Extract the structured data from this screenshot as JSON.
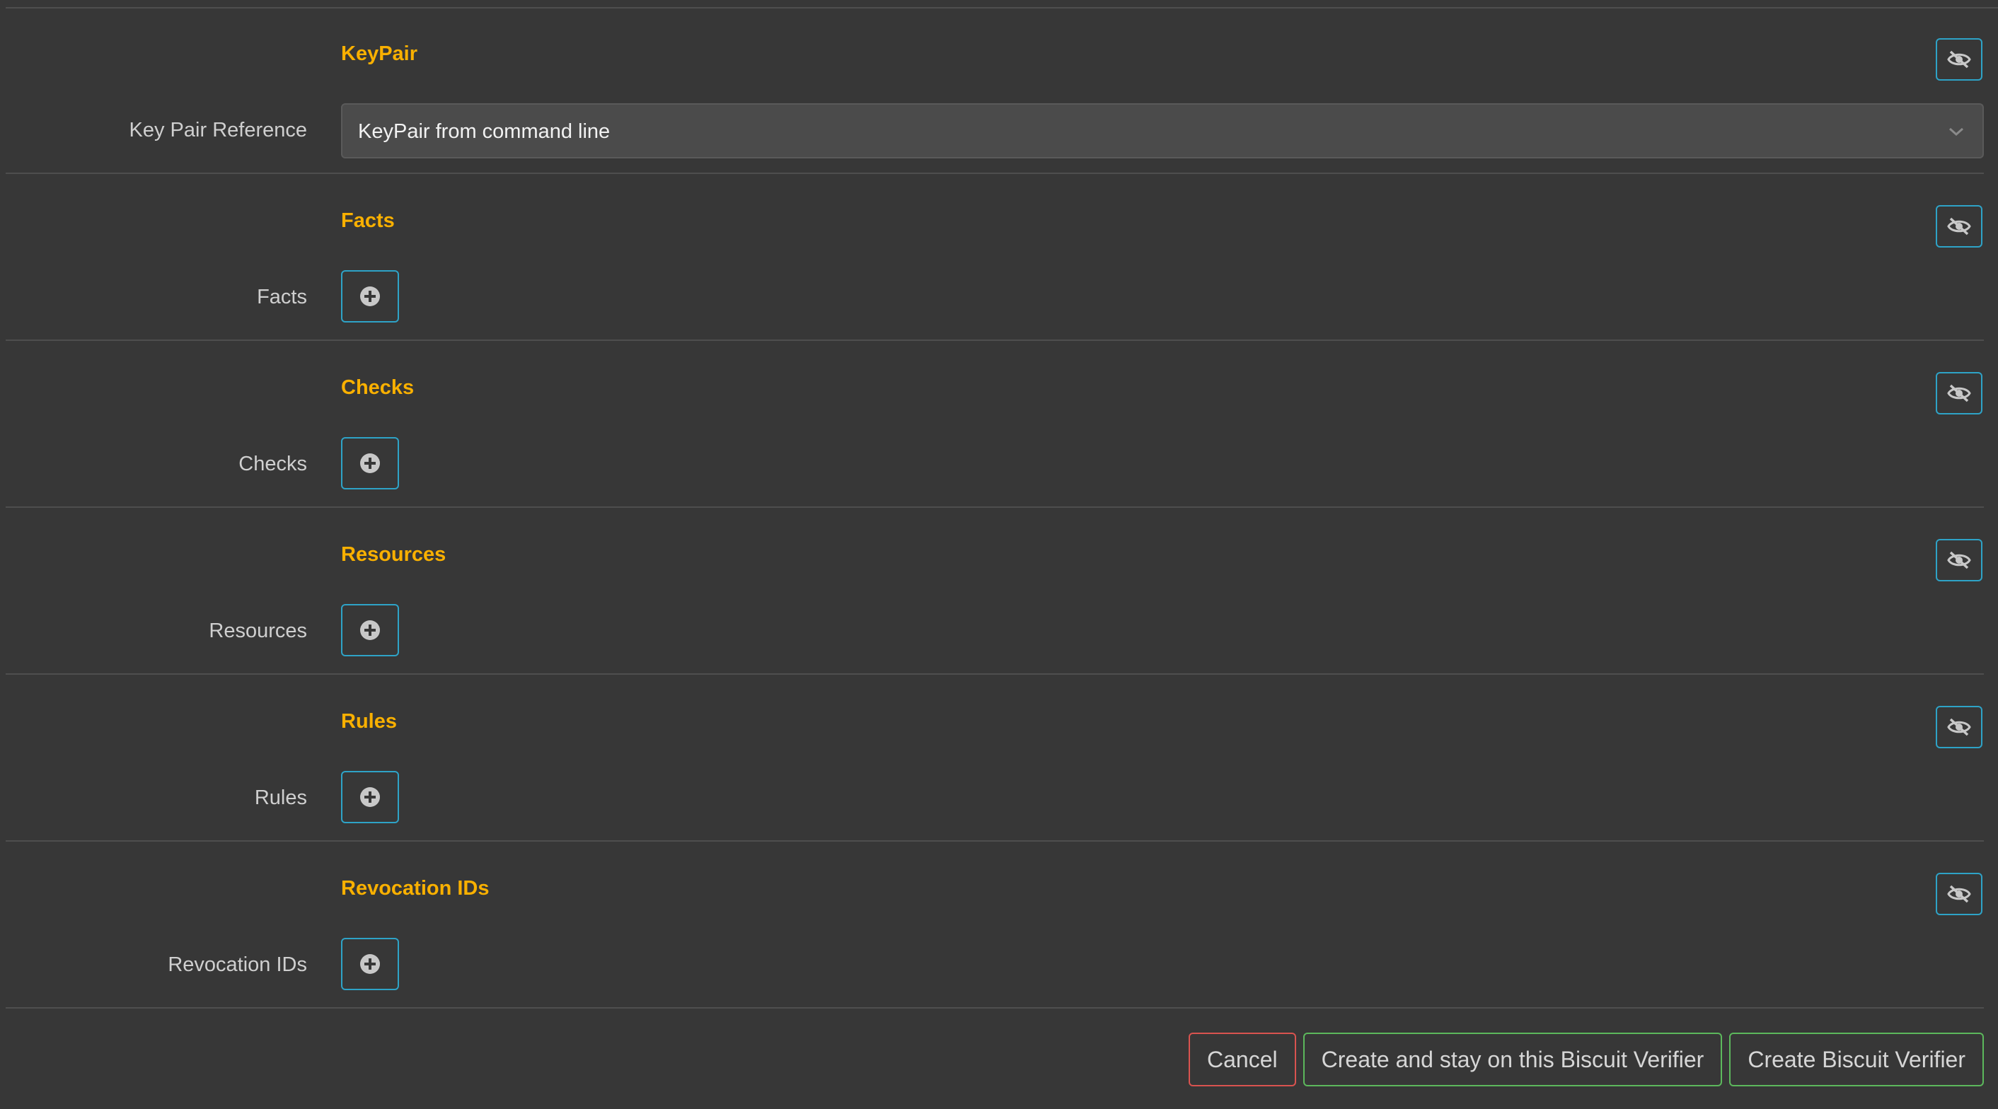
{
  "sections": [
    {
      "id": "keypair",
      "title": "KeyPair",
      "label": "Key Pair Reference",
      "kind": "select",
      "value": "KeyPair from command line"
    },
    {
      "id": "facts",
      "title": "Facts",
      "label": "Facts",
      "kind": "add"
    },
    {
      "id": "checks",
      "title": "Checks",
      "label": "Checks",
      "kind": "add"
    },
    {
      "id": "resources",
      "title": "Resources",
      "label": "Resources",
      "kind": "add"
    },
    {
      "id": "rules",
      "title": "Rules",
      "label": "Rules",
      "kind": "add"
    },
    {
      "id": "revocation",
      "title": "Revocation IDs",
      "label": "Revocation IDs",
      "kind": "add"
    }
  ],
  "icons": {
    "hide": "eye-slash-icon",
    "add": "plus-circle-icon",
    "select": "chevron-down-icon"
  },
  "actions": {
    "cancel": "Cancel",
    "create_stay": "Create and stay on this Biscuit Verifier",
    "create": "Create Biscuit Verifier"
  },
  "colors": {
    "background": "#373737",
    "section_title": "#f9b000",
    "info_border": "#2ea3c7",
    "danger_border": "#d9534f",
    "success_border": "#5cb85c"
  }
}
